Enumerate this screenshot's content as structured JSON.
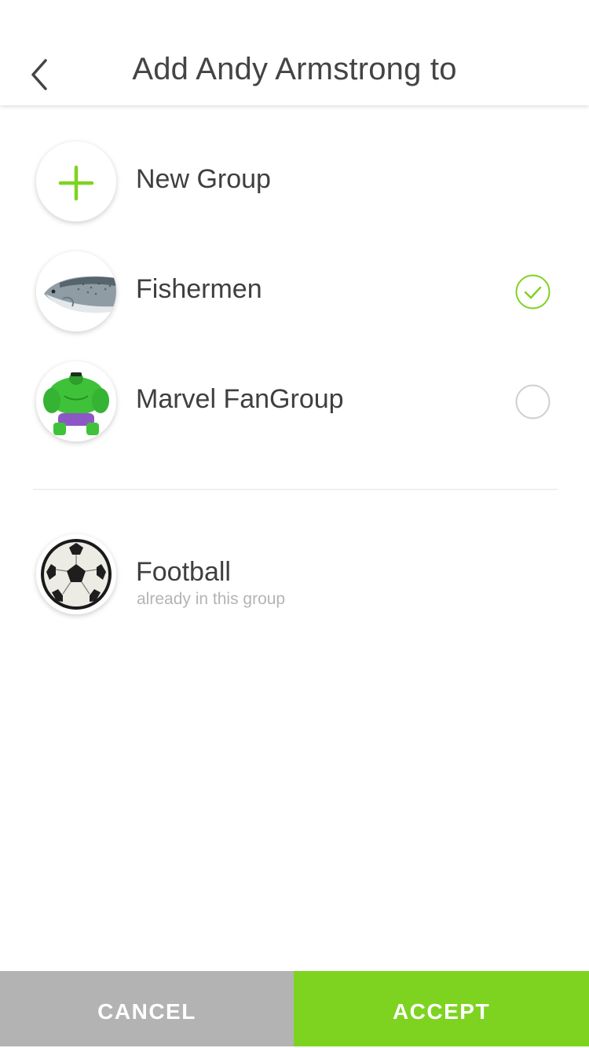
{
  "header": {
    "title": "Add Andy Armstrong to",
    "back_icon": "chevron-left-icon"
  },
  "new_group": {
    "label": "New Group",
    "icon": "plus-icon"
  },
  "groups": [
    {
      "name": "Fishermen",
      "avatar": "salmon-photo",
      "selected": true
    },
    {
      "name": "Marvel FanGroup",
      "avatar": "hulk-figure-photo",
      "selected": false
    }
  ],
  "existing_groups": [
    {
      "name": "Football",
      "avatar": "soccer-ball-photo",
      "status": "already in this group"
    }
  ],
  "footer": {
    "cancel_label": "CANCEL",
    "accept_label": "ACCEPT"
  },
  "colors": {
    "accent": "#7ed321",
    "cancel": "#b3b3b3",
    "text": "#3f3f3f",
    "subtext": "#b4b4b4"
  }
}
